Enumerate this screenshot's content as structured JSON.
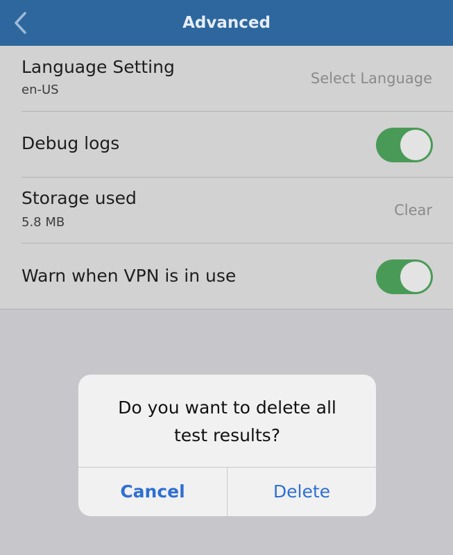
{
  "nav": {
    "title": "Advanced",
    "back_icon": "chevron-left-icon"
  },
  "settings": {
    "language": {
      "title": "Language Setting",
      "value": "en-US",
      "action": "Select Language"
    },
    "debug_logs": {
      "title": "Debug logs",
      "enabled": true
    },
    "storage": {
      "title": "Storage used",
      "value": "5.8 MB",
      "action": "Clear"
    },
    "vpn_warning": {
      "title": "Warn when VPN is in use",
      "enabled": true
    }
  },
  "dialog": {
    "message_line1": "Do you want to delete all",
    "message_line2": "test results?",
    "cancel_label": "Cancel",
    "delete_label": "Delete"
  },
  "colors": {
    "navbar": "#2d679e",
    "toggle_on": "#4a9a57",
    "dialog_button": "#2f6fd1"
  }
}
